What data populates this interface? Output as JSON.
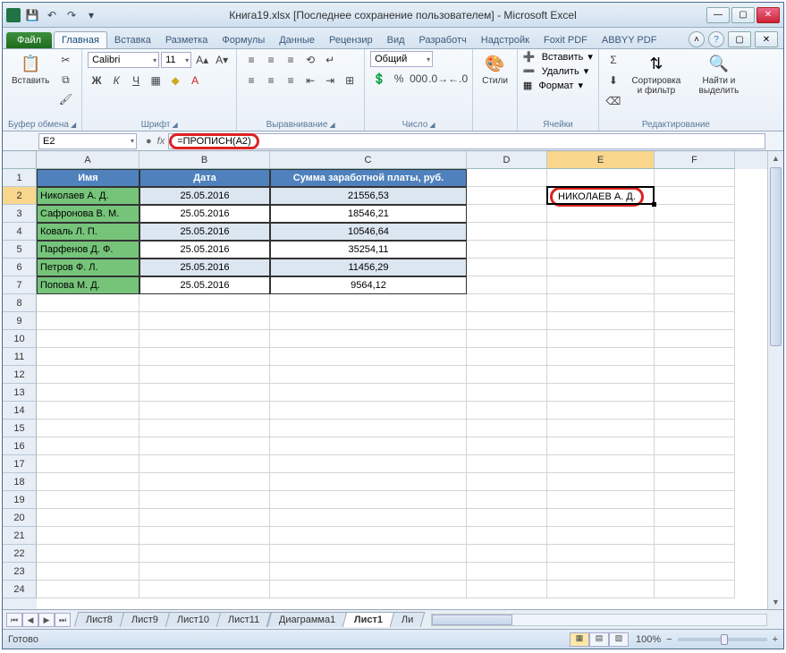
{
  "window": {
    "title": "Книга19.xlsx [Последнее сохранение пользователем] - Microsoft Excel"
  },
  "ribbon": {
    "file": "Файл",
    "tabs": [
      "Главная",
      "Вставка",
      "Разметка",
      "Формулы",
      "Данные",
      "Рецензир",
      "Вид",
      "Разработч",
      "Надстройк",
      "Foxit PDF",
      "ABBYY PDF"
    ],
    "active_tab": 0,
    "groups": {
      "clipboard": {
        "label": "Буфер обмена",
        "paste": "Вставить"
      },
      "font": {
        "label": "Шрифт",
        "name": "Calibri",
        "size": "11"
      },
      "alignment": {
        "label": "Выравнивание"
      },
      "number": {
        "label": "Число",
        "format": "Общий"
      },
      "styles": {
        "label": "Стили",
        "btn": "Стили"
      },
      "cells": {
        "label": "Ячейки",
        "insert": "Вставить",
        "delete": "Удалить",
        "format": "Формат"
      },
      "editing": {
        "label": "Редактирование",
        "sort": "Сортировка и фильтр",
        "find": "Найти и выделить"
      }
    }
  },
  "formula_bar": {
    "name_box": "E2",
    "formula": "=ПРОПИСН(A2)"
  },
  "columns": [
    "A",
    "B",
    "C",
    "D",
    "E",
    "F"
  ],
  "row_count": 24,
  "table": {
    "headers": [
      "Имя",
      "Дата",
      "Сумма заработной платы, руб."
    ],
    "rows": [
      {
        "name": "Николаев А. Д.",
        "date": "25.05.2016",
        "sum": "21556,53"
      },
      {
        "name": "Сафронова В. М.",
        "date": "25.05.2016",
        "sum": "18546,21"
      },
      {
        "name": "Коваль Л. П.",
        "date": "25.05.2016",
        "sum": "10546,64"
      },
      {
        "name": "Парфенов Д. Ф.",
        "date": "25.05.2016",
        "sum": "35254,11"
      },
      {
        "name": "Петров Ф. Л.",
        "date": "25.05.2016",
        "sum": "11456,29"
      },
      {
        "name": "Попова М. Д.",
        "date": "25.05.2016",
        "sum": "9564,12"
      }
    ]
  },
  "result_cell": {
    "ref": "E2",
    "value": "НИКОЛАЕВ А. Д."
  },
  "sheets": {
    "tabs": [
      "Лист8",
      "Лист9",
      "Лист10",
      "Лист11",
      "Диаграмма1",
      "Лист1",
      "Ли"
    ],
    "active": 5
  },
  "status": {
    "ready": "Готово",
    "zoom": "100%"
  }
}
